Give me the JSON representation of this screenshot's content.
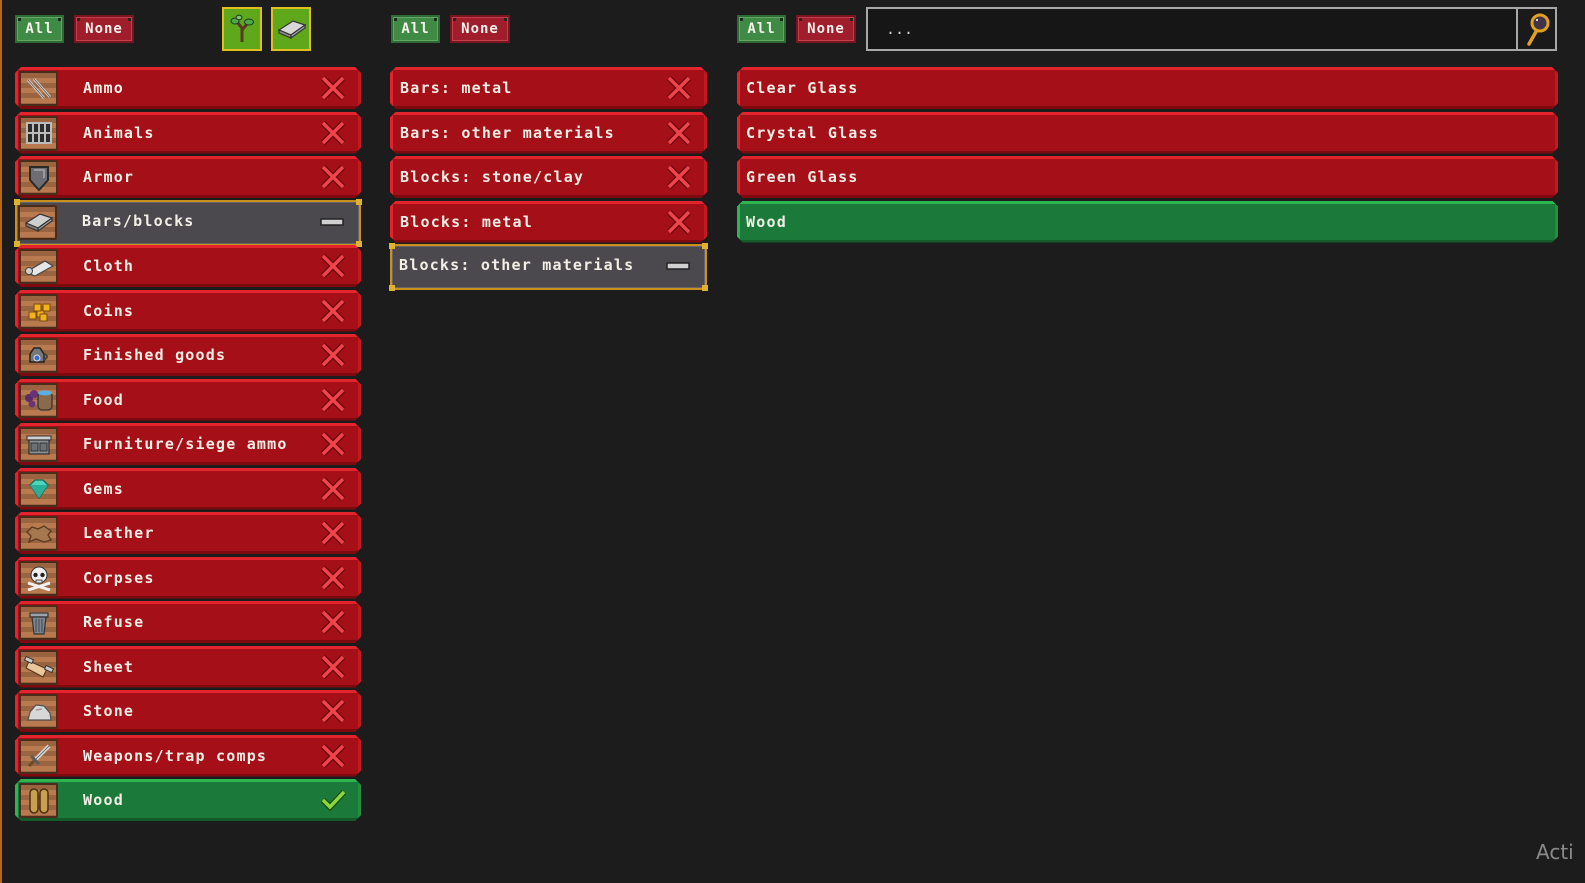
{
  "colors": {
    "enabled": "#1b7a39",
    "disabled": "#a50f17",
    "partial": "#4c494e",
    "background": "#1c1c1c",
    "toggle_active": "#5fa81c"
  },
  "categories": {
    "all_label": "All",
    "none_label": "None",
    "toggles": [
      {
        "name": "organic-toggle",
        "icon": "sapling-icon"
      },
      {
        "name": "inorganic-toggle",
        "icon": "metal-bar-icon"
      }
    ],
    "items": [
      {
        "label": "Ammo",
        "icon": "bolts-icon",
        "state": "off"
      },
      {
        "label": "Animals",
        "icon": "cage-icon",
        "state": "off"
      },
      {
        "label": "Armor",
        "icon": "shield-icon",
        "state": "off"
      },
      {
        "label": "Bars/blocks",
        "icon": "metal-bar-icon",
        "state": "partial"
      },
      {
        "label": "Cloth",
        "icon": "cloth-icon",
        "state": "off"
      },
      {
        "label": "Coins",
        "icon": "coins-icon",
        "state": "off"
      },
      {
        "label": "Finished goods",
        "icon": "jug-icon",
        "state": "off"
      },
      {
        "label": "Food",
        "icon": "food-barrel-icon",
        "state": "off"
      },
      {
        "label": "Furniture/siege ammo",
        "icon": "cabinet-icon",
        "state": "off"
      },
      {
        "label": "Gems",
        "icon": "gem-icon",
        "state": "off"
      },
      {
        "label": "Leather",
        "icon": "hide-icon",
        "state": "off"
      },
      {
        "label": "Corpses",
        "icon": "skull-icon",
        "state": "off"
      },
      {
        "label": "Refuse",
        "icon": "trash-can-icon",
        "state": "off"
      },
      {
        "label": "Sheet",
        "icon": "scroll-icon",
        "state": "off"
      },
      {
        "label": "Stone",
        "icon": "rock-icon",
        "state": "off"
      },
      {
        "label": "Weapons/trap comps",
        "icon": "sword-icon",
        "state": "off"
      },
      {
        "label": "Wood",
        "icon": "logs-icon",
        "state": "on"
      }
    ]
  },
  "subcategories": {
    "all_label": "All",
    "none_label": "None",
    "items": [
      {
        "label": "Bars: metal",
        "state": "off"
      },
      {
        "label": "Bars: other materials",
        "state": "off"
      },
      {
        "label": "Blocks: stone/clay",
        "state": "off"
      },
      {
        "label": "Blocks: metal",
        "state": "off"
      },
      {
        "label": "Blocks: other materials",
        "state": "partial"
      }
    ]
  },
  "materials": {
    "all_label": "All",
    "none_label": "None",
    "search": {
      "placeholder": "...",
      "value": ""
    },
    "items": [
      {
        "label": "Clear Glass",
        "state": "off"
      },
      {
        "label": "Crystal Glass",
        "state": "off"
      },
      {
        "label": "Green Glass",
        "state": "off"
      },
      {
        "label": "Wood",
        "state": "on"
      }
    ]
  },
  "watermark": "Acti"
}
